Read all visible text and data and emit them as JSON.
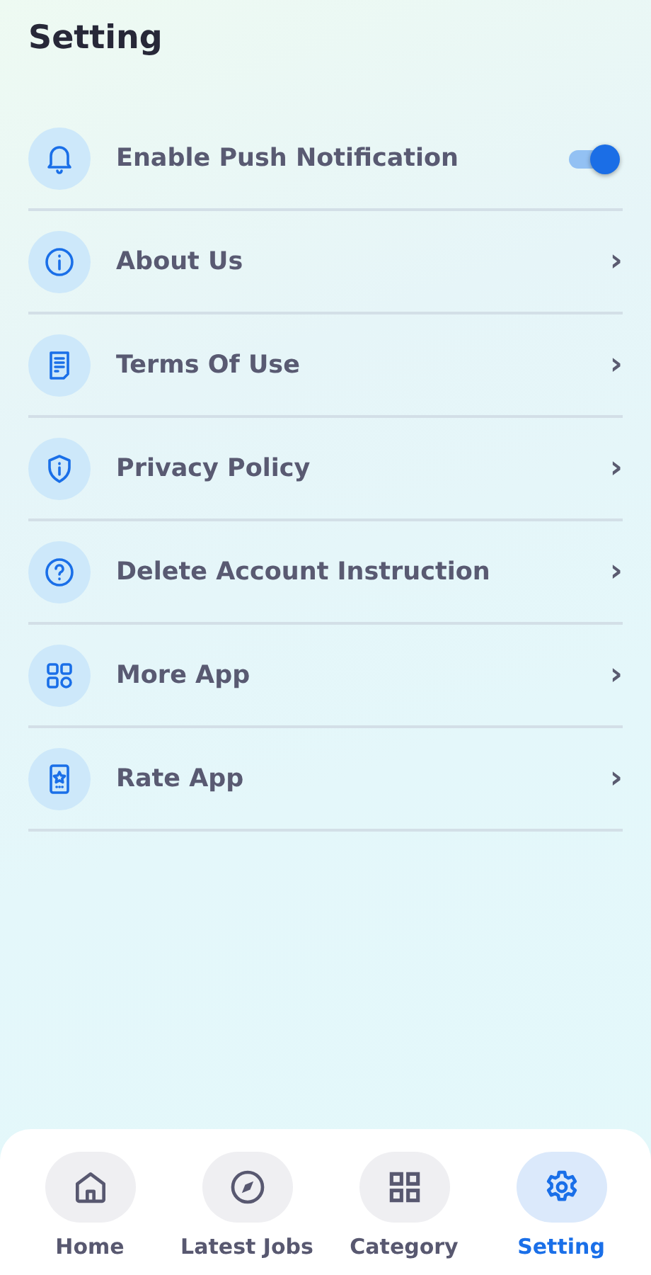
{
  "header": {
    "title": "Setting"
  },
  "settings": [
    {
      "kind": "toggle",
      "label": "Enable Push Notification",
      "on": true
    },
    {
      "kind": "link",
      "label": "About Us",
      "chevron": "›"
    },
    {
      "kind": "link",
      "label": "Terms Of Use",
      "chevron": "›"
    },
    {
      "kind": "link",
      "label": "Privacy Policy",
      "chevron": "›"
    },
    {
      "kind": "link",
      "label": "Delete Account Instruction",
      "chevron": "›"
    },
    {
      "kind": "link",
      "label": "More App",
      "chevron": "›"
    },
    {
      "kind": "link",
      "label": "Rate App",
      "chevron": "›"
    }
  ],
  "bottom_nav": [
    {
      "label": "Home",
      "selected": false
    },
    {
      "label": "Latest Jobs",
      "selected": false
    },
    {
      "label": "Category",
      "selected": false
    },
    {
      "label": "Setting",
      "selected": true
    }
  ]
}
